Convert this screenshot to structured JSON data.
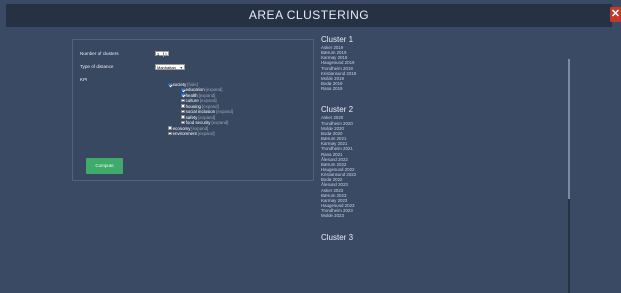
{
  "window": {
    "title": "AREA CLUSTERING",
    "close_label": "✕"
  },
  "form": {
    "clusters_label": "Number of clusters",
    "clusters_value": "3",
    "distance_label": "Type of distance",
    "distance_value": "Manhattan",
    "kpi_label": "KPI",
    "compute_label": "Compute"
  },
  "kpi": {
    "society": {
      "label": "society",
      "expand": "[hide]",
      "checked": true
    },
    "education": {
      "label": "education",
      "expand": "[expand]",
      "checked": true
    },
    "health": {
      "label": "health",
      "expand": "[expand]",
      "checked": true
    },
    "culture": {
      "label": "culture",
      "expand": "[expand]",
      "checked": false
    },
    "housing": {
      "label": "housing",
      "expand": "[expand]",
      "checked": false
    },
    "social_inclusion": {
      "label": "social inclusion",
      "expand": "[expand]",
      "checked": false
    },
    "safety": {
      "label": "safety",
      "expand": "[expand]",
      "checked": false
    },
    "food_security": {
      "label": "food security",
      "expand": "[expand]",
      "checked": false
    },
    "economy": {
      "label": "economy",
      "expand": "[expand]",
      "checked": false
    },
    "environment": {
      "label": "environment",
      "expand": "[expand]",
      "checked": false
    }
  },
  "results": {
    "clusters": [
      {
        "title": "Cluster 1",
        "members": [
          "Asker 2019",
          "Bærum 2019",
          "Karmøy 2019",
          "Haugesund 2019",
          "Trondheim 2019",
          "Kristiansund 2019",
          "Molde 2019",
          "Bodø 2019",
          "Rana 2019"
        ]
      },
      {
        "title": "Cluster 2",
        "members": [
          "Asker 2020",
          "Trondheim 2020",
          "Molde 2020",
          "Bodø 2020",
          "Bærum 2021",
          "Karmøy 2021",
          "Trondheim 2021",
          "Rana 2021",
          "Ålesund 2022",
          "Bærum 2022",
          "Haugesund 2022",
          "Kristiansund 2022",
          "Bodø 2022",
          "Ålesund 2023",
          "Asker 2023",
          "Bærum 2023",
          "Karmøy 2023",
          "Haugesund 2023",
          "Trondheim 2023",
          "Molde 2023"
        ]
      },
      {
        "title": "Cluster 3",
        "members": []
      }
    ]
  }
}
